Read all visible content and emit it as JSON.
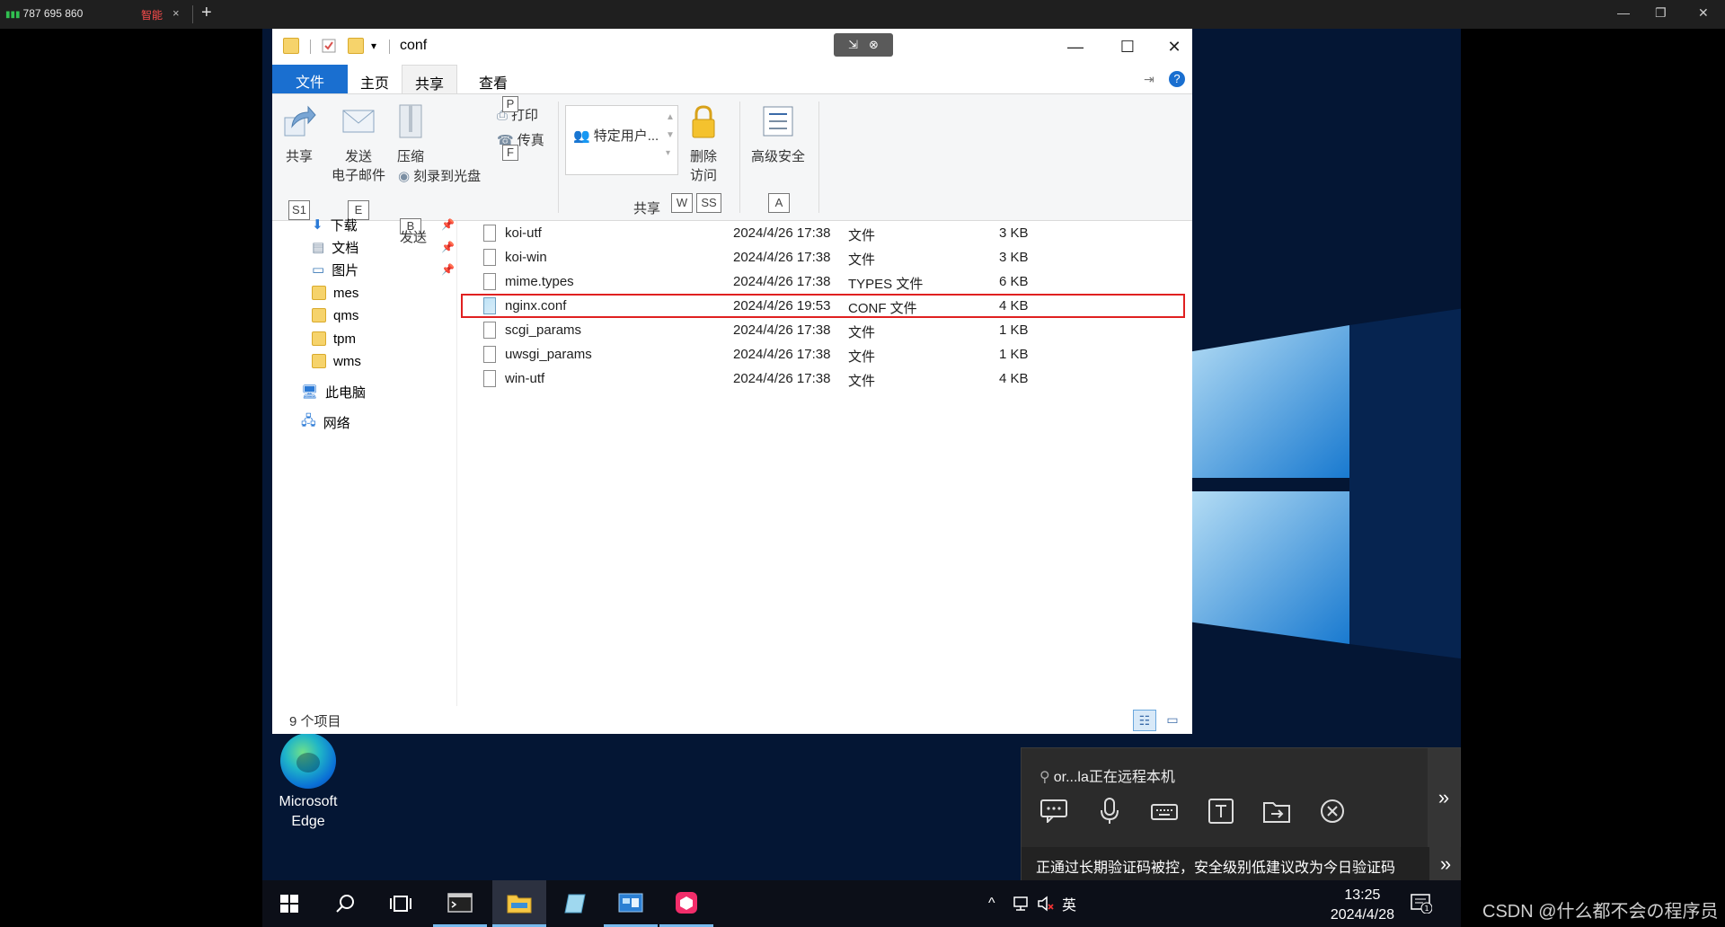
{
  "client": {
    "signal": "787 695 860",
    "tag": "智能",
    "tab_close": "×",
    "new_tab": "+"
  },
  "explorer": {
    "title": "conf",
    "ribbon_tabs": [
      "文件",
      "主页",
      "共享",
      "查看"
    ],
    "ribbon": {
      "share": "共享",
      "email_l1": "发送",
      "email_l2": "电子邮件",
      "zip": "压缩",
      "print": "打印",
      "fax": "传真",
      "burn": "刻录到光盘",
      "send_group": "发送",
      "share_with": "特定用户...",
      "remove_l1": "删除",
      "remove_l2": "访问",
      "advanced": "高级安全",
      "share_group": "共享",
      "keytips": {
        "s1": "S1",
        "e": "E",
        "z": "B",
        "p": "P",
        "f": "F",
        "w": "W",
        "ss": "SS",
        "a": "A"
      }
    },
    "nav": [
      {
        "label": "下载",
        "pinned": true
      },
      {
        "label": "文档",
        "pinned": true
      },
      {
        "label": "图片",
        "pinned": true
      },
      {
        "label": "mes",
        "pinned": false
      },
      {
        "label": "qms",
        "pinned": false
      },
      {
        "label": "tpm",
        "pinned": false
      },
      {
        "label": "wms",
        "pinned": false
      },
      {
        "label": "此电脑",
        "pinned": false
      },
      {
        "label": "网络",
        "pinned": false
      }
    ],
    "files": [
      {
        "name": "koi-utf",
        "date": "2024/4/26 17:38",
        "type": "文件",
        "size": "3 KB"
      },
      {
        "name": "koi-win",
        "date": "2024/4/26 17:38",
        "type": "文件",
        "size": "3 KB"
      },
      {
        "name": "mime.types",
        "date": "2024/4/26 17:38",
        "type": "TYPES 文件",
        "size": "6 KB"
      },
      {
        "name": "nginx.conf",
        "date": "2024/4/26 19:53",
        "type": "CONF 文件",
        "size": "4 KB"
      },
      {
        "name": "scgi_params",
        "date": "2024/4/26 17:38",
        "type": "文件",
        "size": "1 KB"
      },
      {
        "name": "uwsgi_params",
        "date": "2024/4/26 17:38",
        "type": "文件",
        "size": "1 KB"
      },
      {
        "name": "win-utf",
        "date": "2024/4/26 17:38",
        "type": "文件",
        "size": "4 KB"
      }
    ],
    "status": "9 个项目"
  },
  "desktop": {
    "icon_l1": "Microsoft",
    "icon_l2": "Edge"
  },
  "remote_panel": {
    "who": "or...la正在远程本机",
    "notice": "正通过长期验证码被控，安全级别低建议改为今日验证码"
  },
  "taskbar": {
    "ime": "英",
    "time": "13:25",
    "date": "2024/4/28",
    "notif_count": "1"
  },
  "watermark": "CSDN @什么都不会の程序员",
  "colors": {
    "accent": "#1a6fd0",
    "highlight": "#e02020",
    "desktop": "#041634",
    "tag": "#ff4d4d"
  }
}
